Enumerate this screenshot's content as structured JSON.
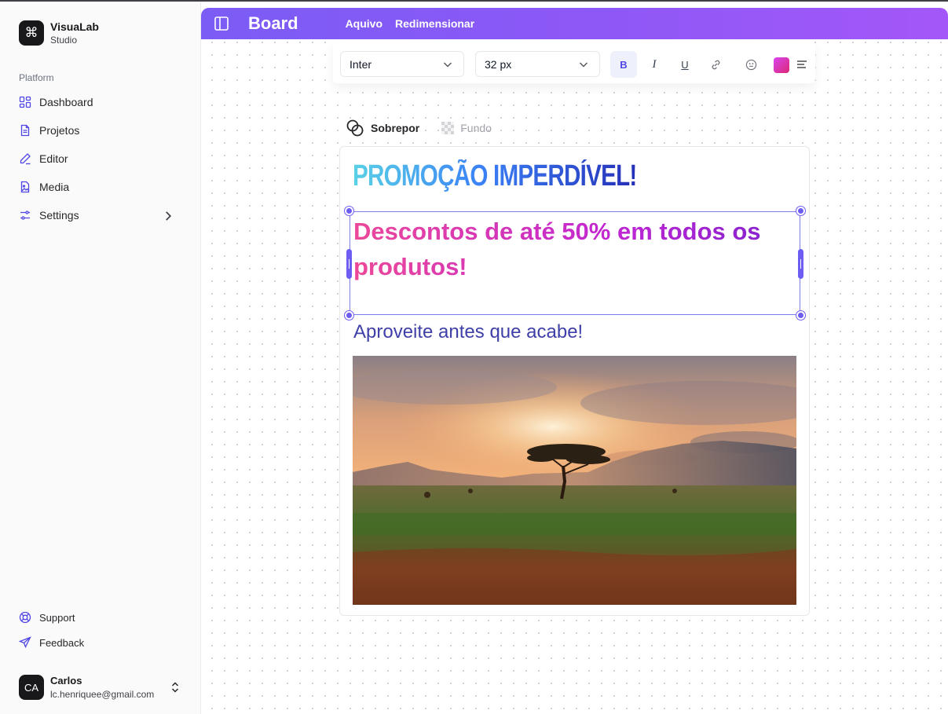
{
  "sidebar": {
    "brand": {
      "name": "VisuaLab",
      "subtitle": "Studio",
      "logo_icon": "command-icon"
    },
    "section_label": "Platform",
    "items": [
      {
        "label": "Dashboard",
        "icon": "dashboard-grid-icon"
      },
      {
        "label": "Projetos",
        "icon": "document-icon"
      },
      {
        "label": "Editor",
        "icon": "pencil-icon"
      },
      {
        "label": "Media",
        "icon": "image-file-icon"
      },
      {
        "label": "Settings",
        "icon": "sliders-icon",
        "has_submenu": true
      }
    ],
    "bottom_items": [
      {
        "label": "Support",
        "icon": "lifebuoy-icon"
      },
      {
        "label": "Feedback",
        "icon": "send-icon"
      }
    ],
    "user": {
      "initials": "CA",
      "name": "Carlos",
      "email": "lc.henriquee@gmail.com"
    }
  },
  "header": {
    "title": "Board",
    "menu": [
      "Aquivo",
      "Redimensionar"
    ],
    "gradient": [
      "#7b5cf5",
      "#a457f8"
    ]
  },
  "toolbar": {
    "font_family": "Inter",
    "font_size": "32 px",
    "bold_label": "B",
    "italic_label": "I",
    "underline_label": "U",
    "bold_active": true,
    "text_color": "#d63ab6"
  },
  "layer_tabs": [
    {
      "label": "Sobrepor",
      "active": true
    },
    {
      "label": "Fundo",
      "active": false
    }
  ],
  "canvas": {
    "title": "PROMOÇÃO IMPERDÍVEL!",
    "headline": "Descontos de até 50% em todos os produtos!",
    "subheading": "Aproveite antes que acabe!",
    "image": "savanna-sunset-acacia-tree",
    "accent_color": "#6d5df3"
  }
}
